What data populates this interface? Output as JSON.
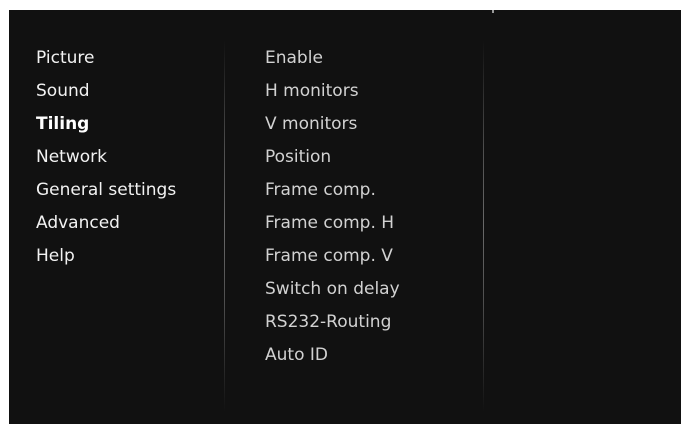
{
  "main_menu": {
    "items": [
      {
        "label": "Picture",
        "selected": false
      },
      {
        "label": "Sound",
        "selected": false
      },
      {
        "label": "Tiling",
        "selected": true
      },
      {
        "label": "Network",
        "selected": false
      },
      {
        "label": "General settings",
        "selected": false
      },
      {
        "label": "Advanced",
        "selected": false
      },
      {
        "label": "Help",
        "selected": false
      }
    ],
    "highlight_color": "#2035a4"
  },
  "tiling_menu": {
    "items": [
      {
        "label": "Enable"
      },
      {
        "label": "H monitors"
      },
      {
        "label": "V monitors"
      },
      {
        "label": "Position"
      },
      {
        "label": "Frame comp."
      },
      {
        "label": "Frame comp. H"
      },
      {
        "label": "Frame comp. V"
      },
      {
        "label": "Switch on delay"
      },
      {
        "label": "RS232-Routing"
      },
      {
        "label": "Auto ID"
      }
    ]
  },
  "colors": {
    "background": "#111111",
    "text": "#f2f2f2",
    "sub_text": "#d2d2d2"
  }
}
